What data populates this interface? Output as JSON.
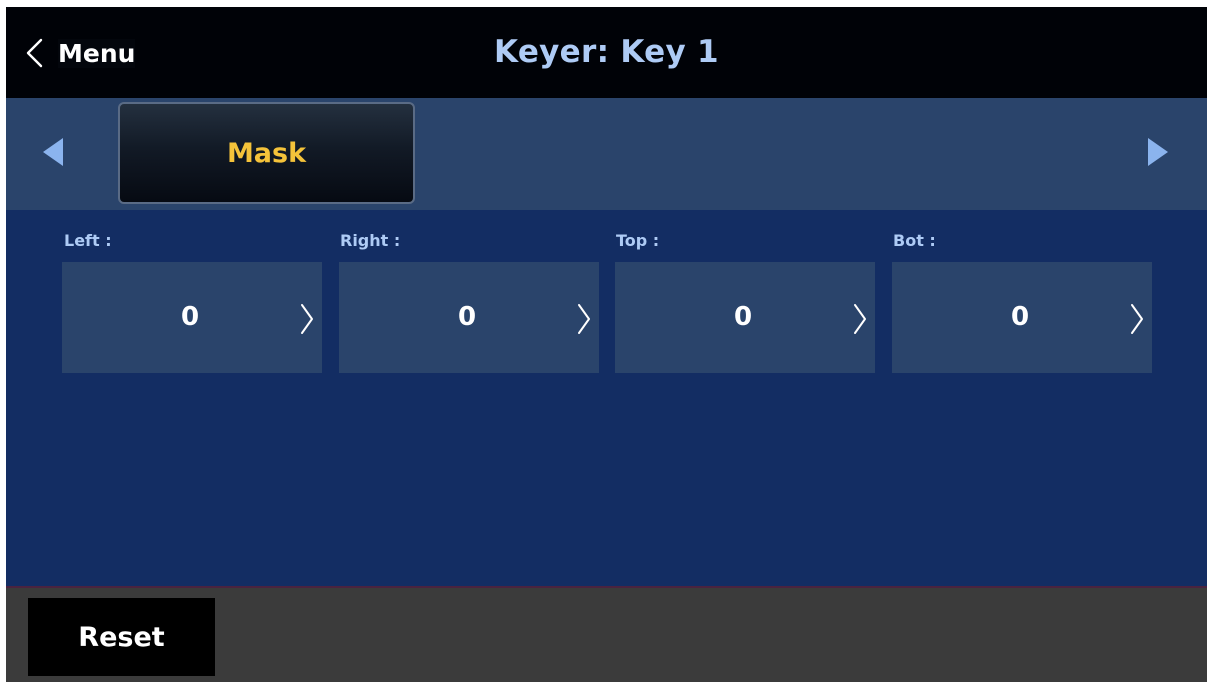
{
  "header": {
    "back_label": "Menu",
    "title": "Keyer: Key 1"
  },
  "tabs": {
    "active_label": "Mask",
    "prev_icon": "arrow-left-icon",
    "next_icon": "arrow-right-icon"
  },
  "fields": [
    {
      "label": "Left :",
      "value": "0"
    },
    {
      "label": "Right :",
      "value": "0"
    },
    {
      "label": "Top :",
      "value": "0"
    },
    {
      "label": "Bot :",
      "value": "0"
    }
  ],
  "footer": {
    "reset_label": "Reset"
  },
  "colors": {
    "title": "#aecbf5",
    "active_tab_text": "#f5c33a",
    "background": "#132d63",
    "panel": "#2a446b",
    "arrow": "#8bb4ee"
  }
}
